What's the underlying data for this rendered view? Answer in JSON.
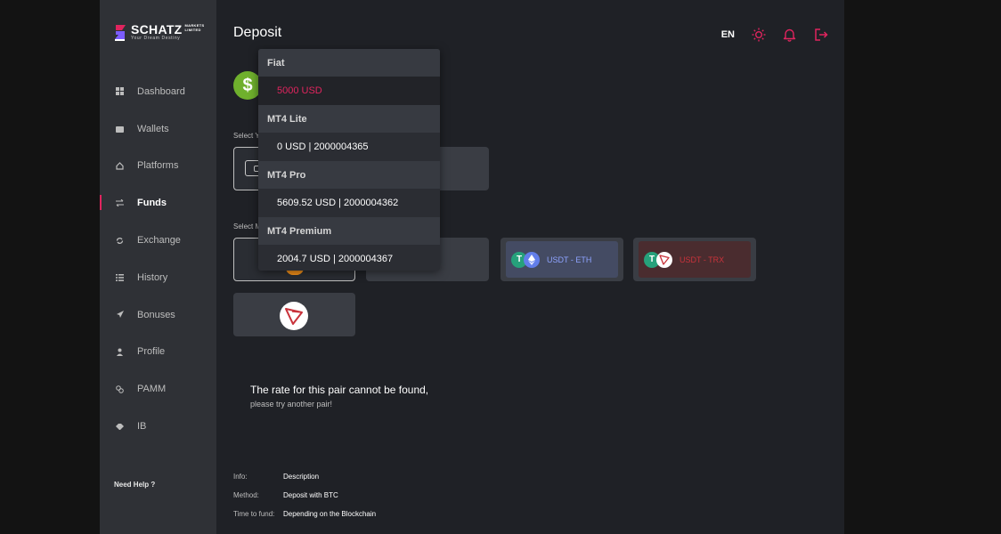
{
  "brand": {
    "name": "SCHATZ",
    "sub_line1": "MARKETS",
    "sub_line2": "LIMITED",
    "tagline": "Your Dream Destiny"
  },
  "sidebar": {
    "items": [
      {
        "label": "Dashboard",
        "icon": "grid-icon",
        "active": false
      },
      {
        "label": "Wallets",
        "icon": "wallet-icon",
        "active": false
      },
      {
        "label": "Platforms",
        "icon": "home-icon",
        "active": false
      },
      {
        "label": "Funds",
        "icon": "transfer-icon",
        "active": true
      },
      {
        "label": "Exchange",
        "icon": "refresh-icon",
        "active": false
      },
      {
        "label": "History",
        "icon": "list-icon",
        "active": false
      },
      {
        "label": "Bonuses",
        "icon": "rocket-icon",
        "active": false
      },
      {
        "label": "Profile",
        "icon": "user-icon",
        "active": false
      },
      {
        "label": "PAMM",
        "icon": "coins-icon",
        "active": false
      },
      {
        "label": "IB",
        "icon": "handshake-icon",
        "active": false
      }
    ],
    "need_help": "Need Help ?"
  },
  "header": {
    "title": "Deposit",
    "language": "EN",
    "icons": [
      "sun-icon",
      "bell-icon",
      "logout-icon"
    ]
  },
  "labels": {
    "select_wallet": "Select Y",
    "select_method": "Select M"
  },
  "methods": [
    {
      "label": "USDT - ETH",
      "icons": [
        "tether-icon",
        "eth-icon"
      ]
    },
    {
      "label": "USDT - TRX",
      "icons": [
        "tether-icon",
        "tron-icon"
      ]
    }
  ],
  "rate_message": {
    "title": "The rate for this pair cannot be found,",
    "subtitle": "please try another pair!"
  },
  "info": {
    "rows": [
      {
        "key": "Info:",
        "value": "Description"
      },
      {
        "key": "Method:",
        "value": "Deposit with BTC"
      },
      {
        "key": "Time to fund:",
        "value": "Depending on the Blockchain"
      }
    ]
  },
  "dropdown": {
    "groups": [
      {
        "label": "Fiat",
        "options": [
          {
            "label": "5000 USD",
            "selected": true
          }
        ]
      },
      {
        "label": "MT4 Lite",
        "options": [
          {
            "label": "0 USD | 2000004365",
            "selected": false
          }
        ]
      },
      {
        "label": "MT4 Pro",
        "options": [
          {
            "label": "5609.52 USD | 2000004362",
            "selected": false
          }
        ]
      },
      {
        "label": "MT4 Premium",
        "options": [
          {
            "label": "2004.7 USD | 2000004367",
            "selected": false
          }
        ]
      }
    ]
  },
  "colors": {
    "accent": "#e0245e",
    "sidebar_bg": "#2f3136",
    "main_bg": "#1f2126",
    "dollar_green": "#6fb02d",
    "tether_green": "#26a17b",
    "eth_blue": "#627eea",
    "tron_red": "#c9333b"
  }
}
